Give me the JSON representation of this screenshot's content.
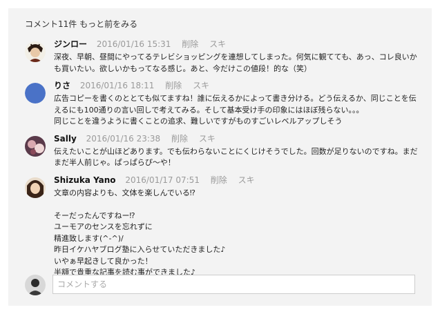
{
  "header": {
    "text": "コメント11件 もっと前をみる"
  },
  "comments": [
    {
      "author": "ジンロー",
      "date": "2016/01/16 15:31",
      "delete_label": "削除",
      "like_label": "スキ",
      "lines": [
        "深夜、早朝、昼間にやってるテレビショッピングを連想してしまった。何気に観てても、あっ、コレ良いか",
        "も買いたい。欲しいかもってなる感じ。あと、今だけこの値段！的な（笑）"
      ]
    },
    {
      "author": "りさ",
      "date": "2016/01/16 18:11",
      "delete_label": "削除",
      "like_label": "スキ",
      "lines": [
        "広告コピーを書くのととても似てますね！誰に伝えるかによって書き分ける。どう伝えるか、同じことを伝",
        "えるにも100通りの言い回しで考えてみる。そして基本受け手の印象にはほぼ残らない。。。",
        "同じことを違うように書くことの追求、難しいですがものすごいレベルアップしそう"
      ]
    },
    {
      "author": "Sally",
      "date": "2016/01/16 23:38",
      "delete_label": "削除",
      "like_label": "スキ",
      "lines": [
        "伝えたいことが山ほどあります。でも伝わらないことにくじけそうでした。回数が足りないのですね。まだ",
        "まだ半人前じゃ。ぱっぱらぴ〜や！"
      ]
    },
    {
      "author": "Shizuka Yano",
      "date": "2016/01/17 07:51",
      "delete_label": "削除",
      "like_label": "スキ",
      "lines": [
        "文章の内容よりも、文体を楽しんでいる⁉",
        "",
        "そーだったんですねー⁉",
        "ユーモアのセンスを忘れずに",
        "精進致します(^-^)/",
        "昨日イケハヤブログ塾に入らせていただきました♪",
        "いやぁ早起きして良かった！",
        "半額で貴重な記事を読む事ができました♪"
      ]
    }
  ],
  "composer": {
    "placeholder": "コメントする"
  }
}
